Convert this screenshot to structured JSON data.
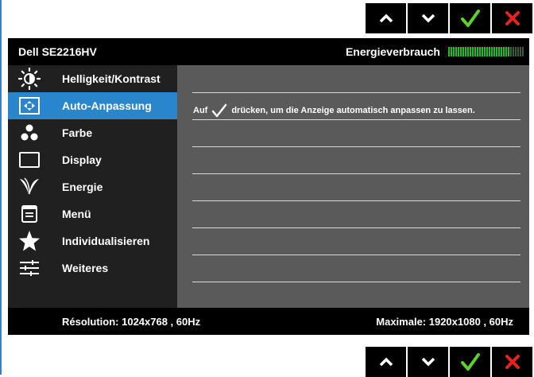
{
  "monitor": {
    "model": "Dell SE2216HV",
    "energy_label": "Energieverbrauch",
    "energy_level": 0.8
  },
  "menu": {
    "items": [
      {
        "label": "Helligkeit/Kontrast",
        "icon": "brightness-icon",
        "active": false
      },
      {
        "label": "Auto-Anpassung",
        "icon": "auto-adjust-icon",
        "active": true
      },
      {
        "label": "Farbe",
        "icon": "color-dots-icon",
        "active": false
      },
      {
        "label": "Display",
        "icon": "display-icon",
        "active": false
      },
      {
        "label": "Energie",
        "icon": "energy-leaf-icon",
        "active": false
      },
      {
        "label": "Menü",
        "icon": "menu-icon",
        "active": false
      },
      {
        "label": "Individualisieren",
        "icon": "star-icon",
        "active": false
      },
      {
        "label": "Weiteres",
        "icon": "sliders-icon",
        "active": false
      }
    ]
  },
  "content": {
    "hint_prefix": "Auf",
    "hint_suffix": "drücken, um die Anzeige automatisch anpassen zu lassen."
  },
  "footer": {
    "resolution": "Résolution: 1024x768 , 60Hz",
    "maximum": "Maximale: 1920x1080 , 60Hz"
  },
  "buttons": {
    "up_icon": "chevron-up-icon",
    "down_icon": "chevron-down-icon",
    "ok_icon": "checkmark-icon",
    "exit_icon": "close-icon",
    "ok_color": "#5cd12a",
    "exit_color": "#e8231f"
  },
  "colors": {
    "highlight": "#2a86cc",
    "sidebar_bg": "#202020",
    "content_bg": "#5a5a5a",
    "meter_on": "#17c224"
  }
}
